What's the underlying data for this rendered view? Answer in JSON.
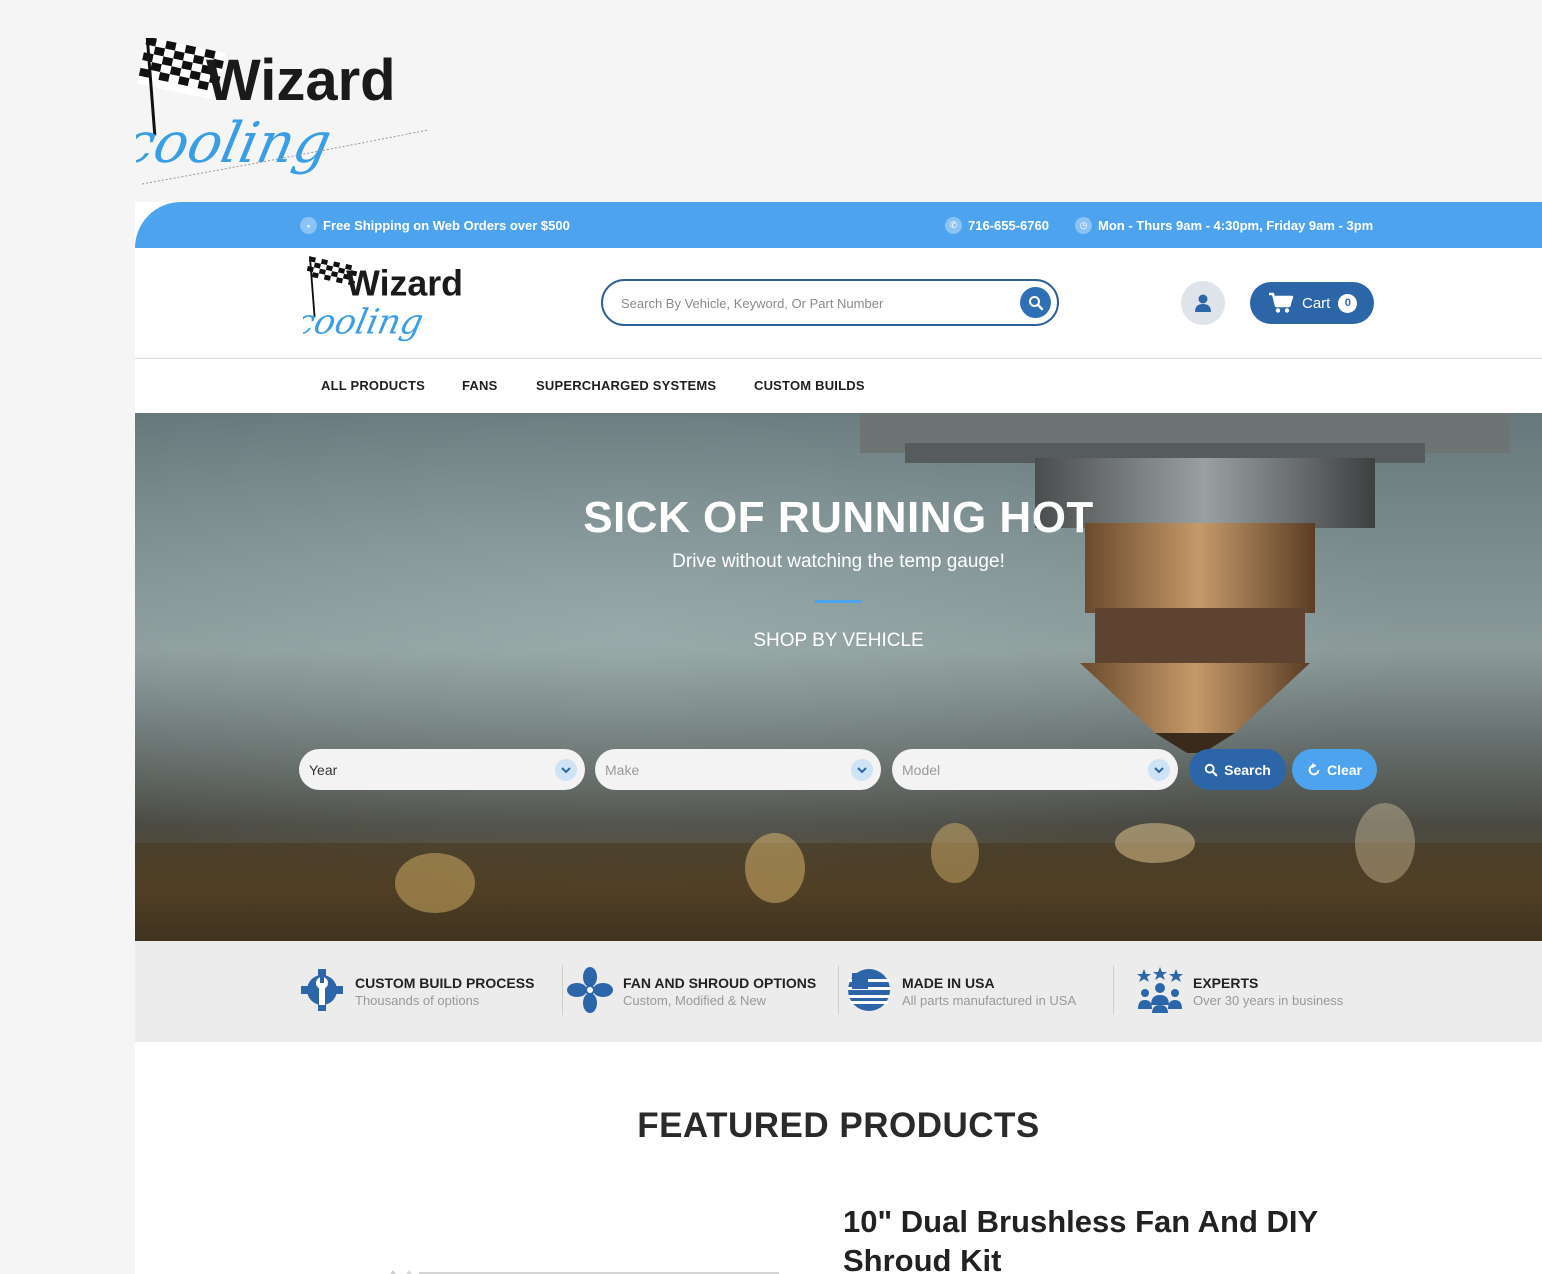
{
  "brand": {
    "logo_top": "Wizard",
    "logo_bottom": "cooling",
    "colors": {
      "primary": "#4ea3ee",
      "dark_blue": "#2d66a8",
      "text": "#222222"
    }
  },
  "topbar": {
    "shipping": "Free Shipping on Web Orders over $500",
    "phone": "716-655-6760",
    "hours": "Mon - Thurs 9am - 4:30pm, Friday 9am - 3pm",
    "icons": [
      "truck-icon",
      "phone-icon",
      "clock-icon"
    ]
  },
  "header": {
    "search_placeholder": "Search By Vehicle, Keyword, Or Part Number",
    "cart_label": "Cart",
    "cart_count": "0"
  },
  "nav": {
    "items": [
      "ALL PRODUCTS",
      "FANS",
      "SUPERCHARGED SYSTEMS",
      "CUSTOM BUILDS"
    ]
  },
  "hero": {
    "title": "SICK OF RUNNING HOT",
    "subtitle": "Drive without watching the temp gauge!",
    "shop_label": "SHOP BY VEHICLE",
    "year": "Year",
    "make": "Make",
    "model": "Model",
    "search_btn": "Search",
    "clear_btn": "Clear"
  },
  "features": [
    {
      "title": "CUSTOM BUILD PROCESS",
      "sub": "Thousands of options",
      "icon": "gear-wrench-icon"
    },
    {
      "title": "FAN AND SHROUD OPTIONS",
      "sub": "Custom, Modified & New",
      "icon": "fan-icon"
    },
    {
      "title": "MADE IN USA",
      "sub": "All parts manufactured in USA",
      "icon": "usa-flag-icon"
    },
    {
      "title": "EXPERTS",
      "sub": "Over 30 years in business",
      "icon": "team-stars-icon"
    }
  ],
  "featured": {
    "title": "FEATURED PRODUCTS",
    "product_title": "10\" Dual Brushless Fan And DIY Shroud Kit"
  }
}
